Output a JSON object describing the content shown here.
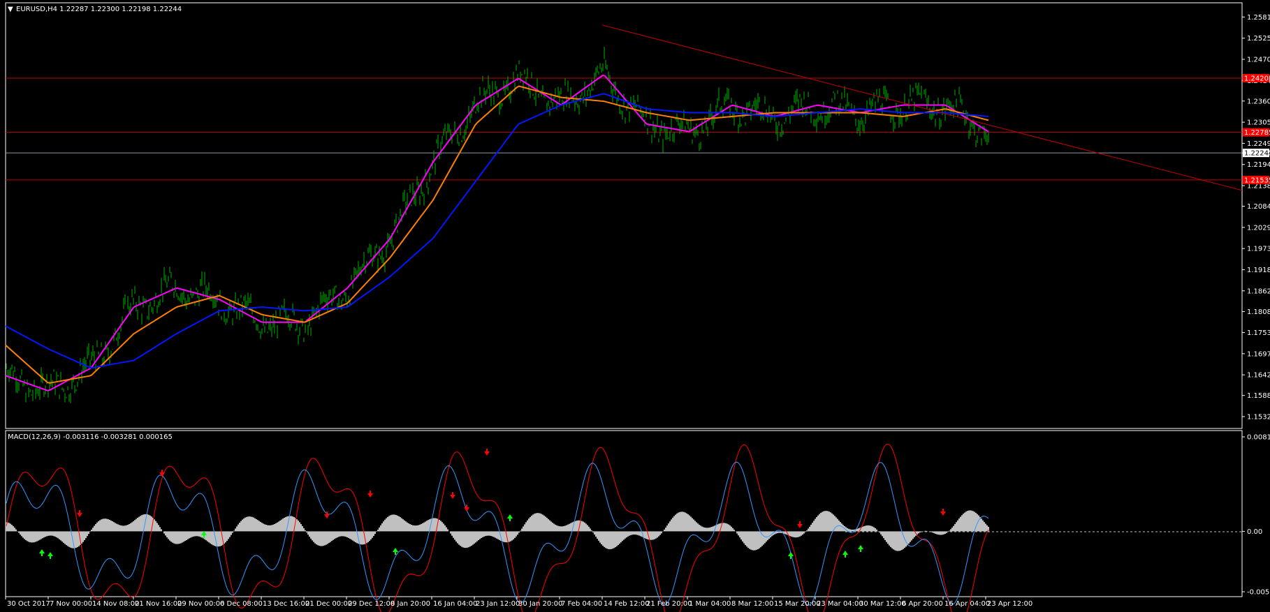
{
  "window": {
    "title": "EURUSD,H4  1.22287 1.22300 1.22198 1.22244",
    "collapse_icon": "triangle-down-icon"
  },
  "colors": {
    "background": "#000000",
    "candle": "#00b000",
    "grid_border": "#ffffff",
    "hline": "#c00000",
    "trendline": "#c00000",
    "ma_fast": "#ff00ff",
    "ma_mid": "#ff7f00",
    "ma_slow": "#0018ff",
    "macd_line": "#3399ff",
    "signal_line": "#ff0000",
    "histogram": "#c0c0c0",
    "arrow_up": "#00ff00",
    "arrow_down": "#ff0000"
  },
  "price_axis": {
    "ticks": [
      "1.25810",
      "1.25255",
      "1.24700",
      "1.24145",
      "1.23605",
      "1.23050",
      "1.22495",
      "1.22244",
      "1.21940",
      "1.21385",
      "1.20845",
      "1.20290",
      "1.19735",
      "1.19180",
      "1.18625",
      "1.18080",
      "1.17530",
      "1.16975",
      "1.16420",
      "1.15880",
      "1.15325"
    ],
    "min": 1.1505,
    "max": 1.26,
    "current_price_label": "1.22244",
    "red_level_labels": [
      {
        "label": "1.24205",
        "price": 1.24205
      },
      {
        "label": "1.22785",
        "price": 1.22785
      },
      {
        "label": "1.21535",
        "price": 1.21535
      }
    ]
  },
  "time_axis": {
    "labels": [
      "30 Oct 2017",
      "7 Nov 00:00",
      "14 Nov 08:00",
      "21 Nov 16:00",
      "29 Nov 00:00",
      "6 Dec 08:00",
      "13 Dec 16:00",
      "21 Dec 00:00",
      "29 Dec 12:00",
      "8 Jan 20:00",
      "16 Jan 04:00",
      "23 Jan 12:00",
      "30 Jan 20:00",
      "7 Feb 04:00",
      "14 Feb 12:00",
      "21 Feb 20:00",
      "1 Mar 04:00",
      "8 Mar 12:00",
      "15 Mar 20:00",
      "23 Mar 04:00",
      "30 Mar 12:00",
      "6 Apr 20:00",
      "16 Apr 04:00",
      "23 Apr 12:00"
    ]
  },
  "macd_panel": {
    "title": "MACD(12,26,9) -0.003116 -0.003281 0.000165",
    "axis_labels": [
      "0.008173",
      "0.00",
      "-0.005225"
    ],
    "max": 0.008173,
    "min": -0.005225
  },
  "chart_data": {
    "type": "line",
    "title": "EURUSD,H4",
    "symbol": "EURUSD",
    "timeframe": "H4",
    "last_bar": {
      "open": 1.22287,
      "high": 1.223,
      "low": 1.22198,
      "close": 1.22244
    },
    "x": [
      "30 Oct 2017",
      "7 Nov 00:00",
      "14 Nov 08:00",
      "21 Nov 16:00",
      "29 Nov 00:00",
      "6 Dec 08:00",
      "13 Dec 16:00",
      "21 Dec 00:00",
      "29 Dec 12:00",
      "8 Jan 20:00",
      "16 Jan 04:00",
      "23 Jan 12:00",
      "30 Jan 20:00",
      "7 Feb 04:00",
      "14 Feb 12:00",
      "21 Feb 20:00",
      "1 Mar 04:00",
      "8 Mar 12:00",
      "15 Mar 20:00",
      "23 Mar 04:00",
      "30 Mar 12:00",
      "6 Apr 20:00",
      "16 Apr 04:00",
      "23 Apr 12:00"
    ],
    "ylim": [
      1.15325,
      1.2581
    ],
    "series": [
      {
        "values": [
          1.164,
          1.16,
          1.166,
          1.182,
          1.187,
          1.184,
          1.178,
          1.178,
          1.187,
          1.2,
          1.22,
          1.235,
          1.242,
          1.235,
          1.243,
          1.23,
          1.228,
          1.235,
          1.232,
          1.235,
          1.233,
          1.235,
          1.235,
          1.228
        ]
      },
      {
        "values": [
          1.172,
          1.162,
          1.164,
          1.175,
          1.182,
          1.185,
          1.18,
          1.178,
          1.183,
          1.195,
          1.21,
          1.23,
          1.24,
          1.237,
          1.236,
          1.233,
          1.231,
          1.232,
          1.233,
          1.233,
          1.233,
          1.232,
          1.234,
          1.231
        ]
      },
      {
        "values": [
          1.177,
          1.171,
          1.166,
          1.168,
          1.175,
          1.181,
          1.182,
          1.181,
          1.182,
          1.19,
          1.2,
          1.215,
          1.23,
          1.235,
          1.238,
          1.234,
          1.233,
          1.233,
          1.232,
          1.233,
          1.234,
          1.233,
          1.233,
          1.232
        ]
      }
    ],
    "horizontal_levels": [
      1.24205,
      1.22785,
      1.22244,
      1.21535
    ],
    "trendline": {
      "from": {
        "x": "14 Feb 12:00",
        "y": 1.256
      },
      "to": {
        "x": "23 Apr 12:00",
        "y": 1.23
      }
    }
  }
}
